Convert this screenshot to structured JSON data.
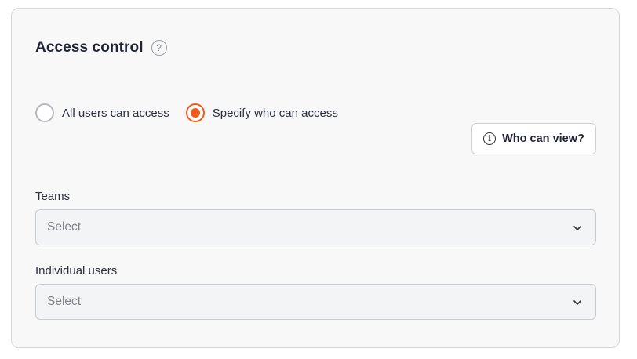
{
  "header": {
    "title": "Access control",
    "help_icon_glyph": "?"
  },
  "access": {
    "options": [
      {
        "label": "All users can access",
        "selected": false
      },
      {
        "label": "Specify who can access",
        "selected": true
      }
    ],
    "accent_color": "#f05a1a"
  },
  "who_can_view": {
    "label": "Who can view?",
    "icon": "info-icon",
    "icon_glyph": "i"
  },
  "teams": {
    "label": "Teams",
    "placeholder": "Select"
  },
  "individual_users": {
    "label": "Individual users",
    "placeholder": "Select"
  }
}
